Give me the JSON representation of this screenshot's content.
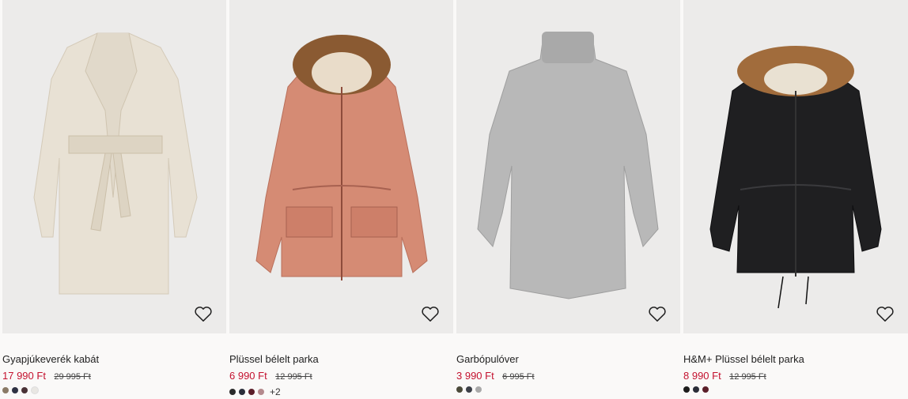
{
  "products": [
    {
      "name": "Gyapjúkeverék kabát",
      "price": "17 990 Ft",
      "old_price": "29 995 Ft",
      "image_icon": "wool-coat-image",
      "colors": [
        "#8a7a66",
        "#2e3142",
        "#4a3236",
        "#e9e7e3"
      ],
      "more_colors": ""
    },
    {
      "name": "Plüssel bélelt parka",
      "price": "6 990 Ft",
      "old_price": "12 995 Ft",
      "image_icon": "parka-image",
      "colors": [
        "#2a2a2a",
        "#2b2e3a",
        "#5b1f2a",
        "#b48a8d"
      ],
      "more_colors": "+2"
    },
    {
      "name": "Garbópulóver",
      "price": "3 990 Ft",
      "old_price": "6 995 Ft",
      "image_icon": "turtleneck-sweater-image",
      "colors": [
        "#4b4a3a",
        "#3c3f47",
        "#a9a9a9"
      ],
      "more_colors": ""
    },
    {
      "name": "H&M+ Plüssel bélelt parka",
      "price": "8 990 Ft",
      "old_price": "12 995 Ft",
      "image_icon": "black-parka-image",
      "colors": [
        "#1c1c1c",
        "#2a2d38",
        "#5b1f2a"
      ],
      "more_colors": ""
    }
  ],
  "favorite_icon": "heart-outline-icon",
  "accent_sale_color": "#c4122f"
}
